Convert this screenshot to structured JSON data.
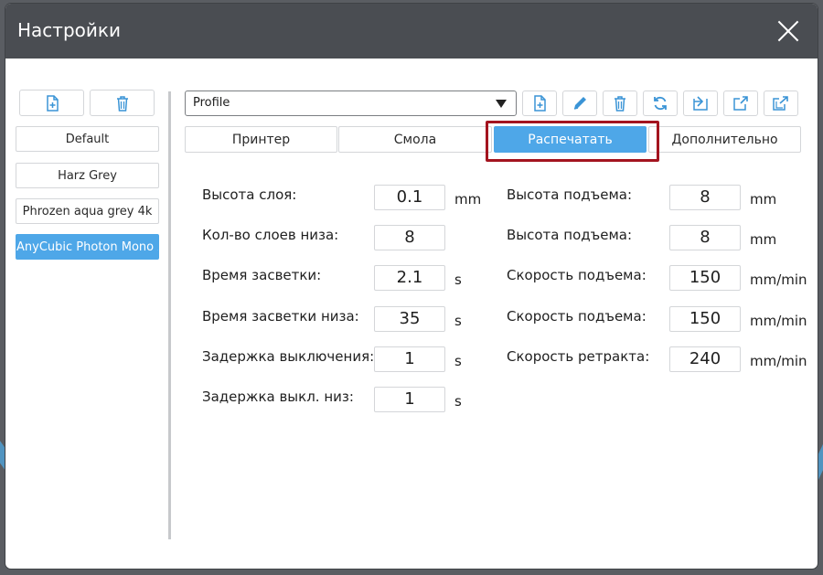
{
  "window": {
    "title": "Настройки"
  },
  "left_panel": {
    "presets": [
      {
        "label": "Default",
        "selected": false
      },
      {
        "label": "Harz Grey",
        "selected": false
      },
      {
        "label": "Phrozen aqua grey 4k",
        "selected": false
      },
      {
        "label": "AnyCubic Photon Mono X",
        "selected": true
      }
    ]
  },
  "profile": {
    "selected": "Profile",
    "toolbar_icons": [
      "add-file-icon",
      "pencil-icon",
      "trash-icon",
      "refresh-icon",
      "import-icon",
      "export-icon",
      "export-all-icon"
    ]
  },
  "tabs": [
    {
      "label": "Принтер",
      "active": false
    },
    {
      "label": "Смола",
      "active": false
    },
    {
      "label": "Распечатать",
      "active": true
    },
    {
      "label": "Дополнительно",
      "active": false
    }
  ],
  "left_fields": [
    {
      "label": "Высота слоя:",
      "value": "0.1",
      "unit": "mm"
    },
    {
      "label": "Кол-во слоев низа:",
      "value": "8",
      "unit": ""
    },
    {
      "label": "Время засветки:",
      "value": "2.1",
      "unit": "s"
    },
    {
      "label": "Время засветки низа:",
      "value": "35",
      "unit": "s"
    },
    {
      "label": "Задержка выключения:",
      "value": "1",
      "unit": "s"
    },
    {
      "label": "Задержка выкл. низ:",
      "value": "1",
      "unit": "s"
    }
  ],
  "right_fields": [
    {
      "label": "Высота подъема:",
      "value": "8",
      "unit": "mm"
    },
    {
      "label": "Высота подъема:",
      "value": "8",
      "unit": "mm"
    },
    {
      "label": "Скорость подъема:",
      "value": "150",
      "unit": "mm/min"
    },
    {
      "label": "Скорость подъема:",
      "value": "150",
      "unit": "mm/min"
    },
    {
      "label": "Скорость ретракта:",
      "value": "240",
      "unit": "mm/min"
    }
  ],
  "colors": {
    "accent": "#4ea7e8",
    "highlight": "#a3141f",
    "titlebar": "#4a4d52"
  }
}
